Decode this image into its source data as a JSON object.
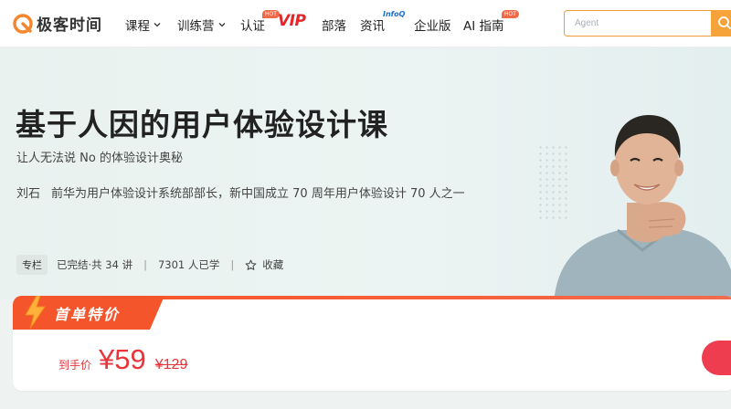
{
  "nav": {
    "logo_text": "极客时间",
    "items": [
      {
        "label": "课程"
      },
      {
        "label": "训练营"
      },
      {
        "label": "认证"
      },
      {
        "label": "部落"
      },
      {
        "label": "资讯"
      },
      {
        "label": "企业版"
      },
      {
        "label": "AI 指南"
      }
    ],
    "hot_badge": "HOT",
    "vip_label": "VIP",
    "infoq_label": "InfoQ",
    "search_placeholder": "Agent"
  },
  "course": {
    "title": "基于人因的用户体验设计课",
    "subtitle": "让人无法说 No 的体验设计奥秘",
    "author_name": "刘石",
    "author_bio": "前华为用户体验设计系统部部长，新中国成立 70 周年用户体验设计 70 人之一",
    "tag": "专栏",
    "status": "已完结·共 34 讲",
    "learners": "7301 人已学",
    "favorite_label": "收藏"
  },
  "offer": {
    "promo_label": "首单特价",
    "price_label": "到手价",
    "price_now": "¥59",
    "price_old": "¥129"
  },
  "colors": {
    "accent_orange": "#f5a33a",
    "price_red": "#e8343a",
    "promo_red": "#f5552a",
    "vip_red": "#e5252a",
    "infoq_blue": "#1c6fd6"
  }
}
